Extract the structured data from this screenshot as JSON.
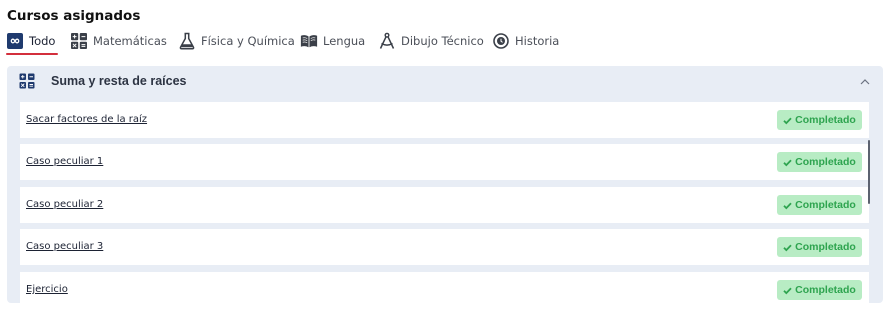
{
  "page": {
    "title": "Cursos asignados"
  },
  "tabs": [
    {
      "label": "Todo",
      "icon": "infinity-icon",
      "active": true
    },
    {
      "label": "Matemáticas",
      "icon": "grid-calculator-icon",
      "active": false
    },
    {
      "label": "Física y Química",
      "icon": "flask-icon",
      "active": false
    },
    {
      "label": "Lengua",
      "icon": "open-book-icon",
      "active": false
    },
    {
      "label": "Dibujo Técnico",
      "icon": "compass-icon",
      "active": false
    },
    {
      "label": "Historia",
      "icon": "history-clock-icon",
      "active": false
    }
  ],
  "section": {
    "title": "Suma y resta de raíces",
    "icon": "grid-calculator-icon",
    "collapse_icon": "chevron-up-icon",
    "items": [
      {
        "label": "Sacar factores de la raíz",
        "status": "Completado"
      },
      {
        "label": "Caso peculiar 1",
        "status": "Completado"
      },
      {
        "label": "Caso peculiar 2",
        "status": "Completado"
      },
      {
        "label": "Caso peculiar 3",
        "status": "Completado"
      },
      {
        "label": "Ejercicio",
        "status": "Completado"
      }
    ]
  },
  "colors": {
    "accent_underline": "#d32f3c",
    "active_tab_icon_bg": "#1f3a6e",
    "panel_bg": "#e8edf5",
    "badge_bg": "#b8ecc4",
    "badge_text": "#2ea44f"
  }
}
